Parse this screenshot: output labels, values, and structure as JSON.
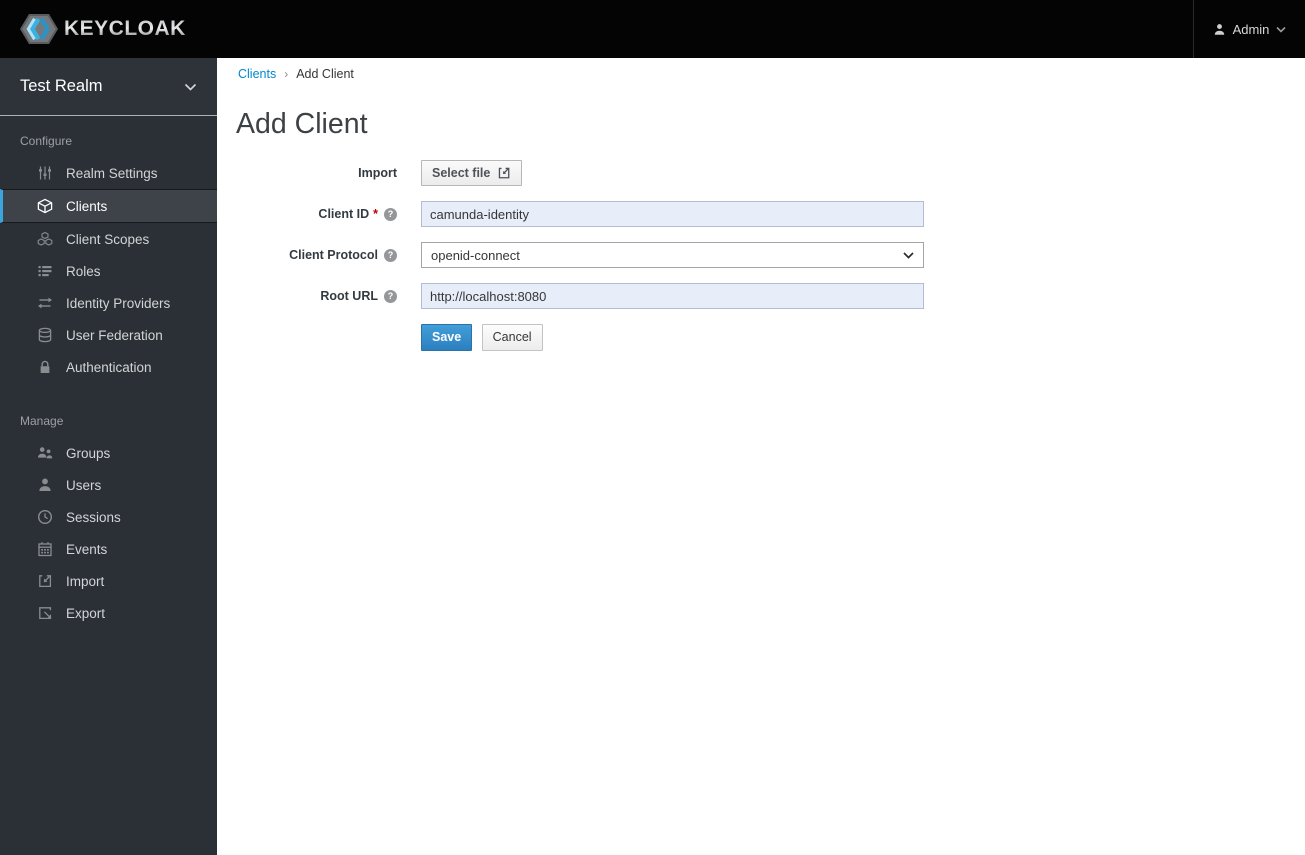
{
  "topbar": {
    "brand": "KEYCLOAK",
    "user_menu": {
      "label": "Admin"
    }
  },
  "sidebar": {
    "realm_selector": {
      "label": "Test Realm"
    },
    "sections": [
      {
        "label": "Configure",
        "items": [
          {
            "label": "Realm Settings",
            "icon": "sliders-icon",
            "active": false
          },
          {
            "label": "Clients",
            "icon": "cube-icon",
            "active": true
          },
          {
            "label": "Client Scopes",
            "icon": "cubes-icon",
            "active": false
          },
          {
            "label": "Roles",
            "icon": "list-icon",
            "active": false
          },
          {
            "label": "Identity Providers",
            "icon": "exchange-icon",
            "active": false
          },
          {
            "label": "User Federation",
            "icon": "database-icon",
            "active": false
          },
          {
            "label": "Authentication",
            "icon": "lock-icon",
            "active": false
          }
        ]
      },
      {
        "label": "Manage",
        "items": [
          {
            "label": "Groups",
            "icon": "groups-icon",
            "active": false
          },
          {
            "label": "Users",
            "icon": "user-icon",
            "active": false
          },
          {
            "label": "Sessions",
            "icon": "clock-icon",
            "active": false
          },
          {
            "label": "Events",
            "icon": "calendar-icon",
            "active": false
          },
          {
            "label": "Import",
            "icon": "import-icon",
            "active": false
          },
          {
            "label": "Export",
            "icon": "export-icon",
            "active": false
          }
        ]
      }
    ]
  },
  "breadcrumb": {
    "link": "Clients",
    "separator": "›",
    "current": "Add Client"
  },
  "page": {
    "title": "Add Client"
  },
  "form": {
    "help_glyph": "?",
    "import": {
      "label": "Import",
      "button_label": "Select file"
    },
    "client_id": {
      "label": "Client ID",
      "required_marker": "*",
      "value": "camunda-identity"
    },
    "client_protocol": {
      "label": "Client Protocol",
      "value": "openid-connect"
    },
    "root_url": {
      "label": "Root URL",
      "value": "http://localhost:8080"
    },
    "save_label": "Save",
    "cancel_label": "Cancel"
  },
  "colors": {
    "topbar_bg": "#040404",
    "sidebar_bg": "#2b3036",
    "active_nav_bg": "#3e434a",
    "active_nav_border": "#39a5dc",
    "link": "#0088ce",
    "input_filled_bg": "#e8eef9",
    "save_button": "#2d7fc0",
    "required": "#c00000"
  }
}
